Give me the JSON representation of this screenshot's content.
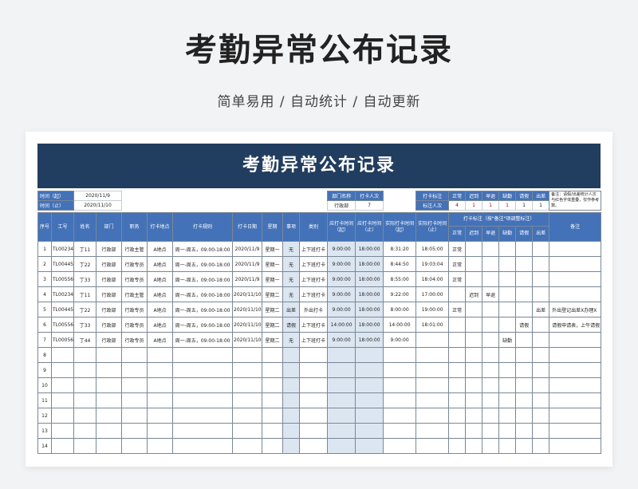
{
  "page": {
    "title": "考勤异常公布记录",
    "subtitle": "简单易用 / 自动统计 / 自动更新"
  },
  "sheet": {
    "title": "考勤异常公布记录",
    "time_start_label": "时间（起）",
    "time_start": "2020/11/9",
    "time_end_label": "时间（止）",
    "time_end": "2020/11/10",
    "dept_name_label": "部门名称",
    "dept_name": "行政部",
    "clockin_count_label": "打卡人次",
    "clockin_count": "7",
    "clock_mark_label": "打卡标注",
    "mark_count_label": "标注人次",
    "summary_headers": [
      "正常",
      "迟到",
      "早退",
      "缺勤",
      "请假",
      "出差"
    ],
    "summary_values": [
      "4",
      "1",
      "1",
      "1",
      "1",
      "1"
    ],
    "note": "备注：请假/出差统计人次与红色字体重叠，仅作参考数。",
    "columns": {
      "seq": "序号",
      "emp_id": "工号",
      "name": "姓名",
      "dept": "部门",
      "position": "职务",
      "location": "打卡地点",
      "rule": "打卡规则",
      "date": "打卡日期",
      "weekday": "星期",
      "matter": "事项",
      "type": "类别",
      "should_start": "应打卡时间（起）",
      "should_end": "应打卡时间（止）",
      "actual_start": "实际打卡时间（起）",
      "actual_end": "实际打卡时间（止）",
      "mark_group": "打卡标注（按\"备注\"项调整标注）",
      "mark_normal": "正常",
      "mark_late": "迟到",
      "mark_early": "早退",
      "mark_absent": "缺勤",
      "mark_leave": "请假",
      "mark_trip": "出差",
      "remark": "备注"
    },
    "rows": [
      {
        "seq": "1",
        "emp_id": "TL00234",
        "name": "丁11",
        "dept": "行政部",
        "position": "行政主管",
        "location": "A地点",
        "rule": "周一-周五，09:00-18:00",
        "date": "2020/11/9",
        "weekday": "星期一",
        "matter": "无",
        "type": "上下班打卡",
        "should_start": "9:00:00",
        "should_end": "18:00:00",
        "actual_start": "8:31:20",
        "actual_end": "18:05:00",
        "normal": "正常",
        "late": "",
        "early": "",
        "absent": "",
        "leave": "",
        "trip": "",
        "remark": ""
      },
      {
        "seq": "2",
        "emp_id": "TL00445",
        "name": "丁22",
        "dept": "行政部",
        "position": "行政专员",
        "location": "A地点",
        "rule": "周一-周五，09:00-18:00",
        "date": "2020/11/9",
        "weekday": "星期一",
        "matter": "无",
        "type": "上下班打卡",
        "should_start": "9:00:00",
        "should_end": "18:00:00",
        "actual_start": "8:44:50",
        "actual_end": "19:03:04",
        "normal": "正常",
        "late": "",
        "early": "",
        "absent": "",
        "leave": "",
        "trip": "",
        "remark": ""
      },
      {
        "seq": "3",
        "emp_id": "TL00556",
        "name": "丁33",
        "dept": "行政部",
        "position": "行政专员",
        "location": "A地点",
        "rule": "周一-周五，09:00-18:00",
        "date": "2020/11/9",
        "weekday": "星期一",
        "matter": "无",
        "type": "上下班打卡",
        "should_start": "9:00:00",
        "should_end": "18:00:00",
        "actual_start": "8:55:00",
        "actual_end": "18:04:00",
        "normal": "正常",
        "late": "",
        "early": "",
        "absent": "",
        "leave": "",
        "trip": "",
        "remark": ""
      },
      {
        "seq": "4",
        "emp_id": "TL00234",
        "name": "丁11",
        "dept": "行政部",
        "position": "行政主管",
        "location": "A地点",
        "rule": "周一-周五，09:00-18:00",
        "date": "2020/11/10",
        "weekday": "星期二",
        "matter": "无",
        "type": "上下班打卡",
        "should_start": "9:00:00",
        "should_end": "18:00:00",
        "actual_start": "9:22:00",
        "actual_end": "17:00:00",
        "normal": "",
        "late": "迟到",
        "early": "早退",
        "absent": "",
        "leave": "",
        "trip": "",
        "remark": ""
      },
      {
        "seq": "5",
        "emp_id": "TL00445",
        "name": "丁22",
        "dept": "行政部",
        "position": "行政专员",
        "location": "A地点",
        "rule": "周一-周五，09:00-18:00",
        "date": "2020/11/10",
        "weekday": "星期二",
        "matter": "出差",
        "type": "外出打卡",
        "should_start": "9:00:00",
        "should_end": "18:00:00",
        "actual_start": "8:00:00",
        "actual_end": "19:00:00",
        "normal": "正常",
        "late": "",
        "early": "",
        "absent": "",
        "leave": "",
        "trip": "出差",
        "remark": "外出登记出差X办理X"
      },
      {
        "seq": "6",
        "emp_id": "TL00556",
        "name": "丁33",
        "dept": "行政部",
        "position": "行政专员",
        "location": "A地点",
        "rule": "周一-周五，09:00-18:00",
        "date": "2020/11/10",
        "weekday": "星期二",
        "matter": "请假",
        "type": "上下班打卡",
        "should_start": "14:00:00",
        "should_end": "18:00:00",
        "actual_start": "14:00:00",
        "actual_end": "18:01:00",
        "normal": "",
        "late": "",
        "early": "",
        "absent": "",
        "leave": "请假",
        "trip": "",
        "remark": "请假申请表，上午请假"
      },
      {
        "seq": "7",
        "emp_id": "TL00056",
        "name": "丁44",
        "dept": "行政部",
        "position": "行政专员",
        "location": "A地点",
        "rule": "周一-周五，09:00-18:00",
        "date": "2020/11/10",
        "weekday": "星期二",
        "matter": "无",
        "type": "上下班打卡",
        "should_start": "9:00:00",
        "should_end": "18:00:00",
        "actual_start": "9:00:00",
        "actual_end": "",
        "normal": "",
        "late": "",
        "early": "",
        "absent": "缺勤",
        "leave": "",
        "trip": "",
        "remark": ""
      }
    ],
    "empty_rows": [
      "8",
      "9",
      "10",
      "11",
      "12",
      "13",
      "14"
    ]
  }
}
